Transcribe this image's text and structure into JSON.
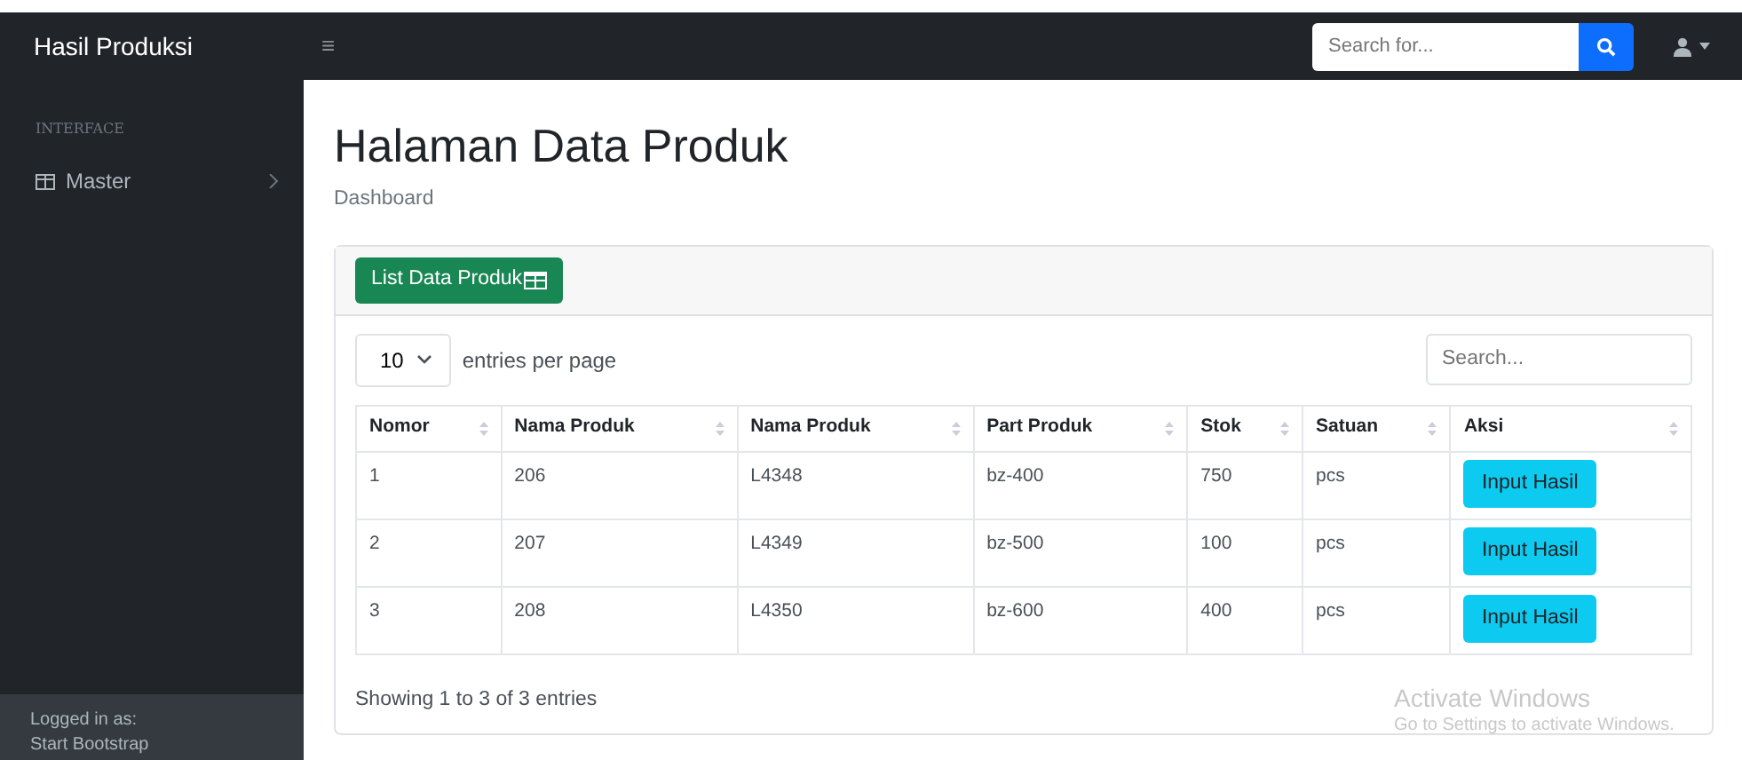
{
  "navbar": {
    "brand": "Hasil Produksi",
    "toggle": "≡",
    "search": {
      "placeholder": "Search for..."
    }
  },
  "sidebar": {
    "heading": "INTERFACE",
    "items": [
      {
        "label": "Master",
        "expanded": false
      }
    ],
    "footer": {
      "label": "Logged in as:",
      "user": "Start Bootstrap"
    }
  },
  "page": {
    "title": "Halaman Data Produk",
    "breadcrumb": "Dashboard"
  },
  "card": {
    "header_button": "List Data Produk",
    "entries": {
      "value": "10",
      "label": "entries per page"
    },
    "search": {
      "placeholder": "Search..."
    },
    "table": {
      "columns": [
        "Nomor",
        "Nama Produk",
        "Nama Produk",
        "Part Produk",
        "Stok",
        "Satuan",
        "Aksi"
      ],
      "rows": [
        {
          "cells": [
            "1",
            "206",
            "L4348",
            "bz-400",
            "750",
            "pcs"
          ],
          "action": "Input Hasil"
        },
        {
          "cells": [
            "2",
            "207",
            "L4349",
            "bz-500",
            "100",
            "pcs"
          ],
          "action": "Input Hasil"
        },
        {
          "cells": [
            "3",
            "208",
            "L4350",
            "bz-600",
            "400",
            "pcs"
          ],
          "action": "Input Hasil"
        }
      ]
    },
    "info": "Showing 1 to 3 of 3 entries"
  },
  "os_notice": {
    "title": "Activate Windows",
    "text": "Go to Settings to activate Windows."
  }
}
